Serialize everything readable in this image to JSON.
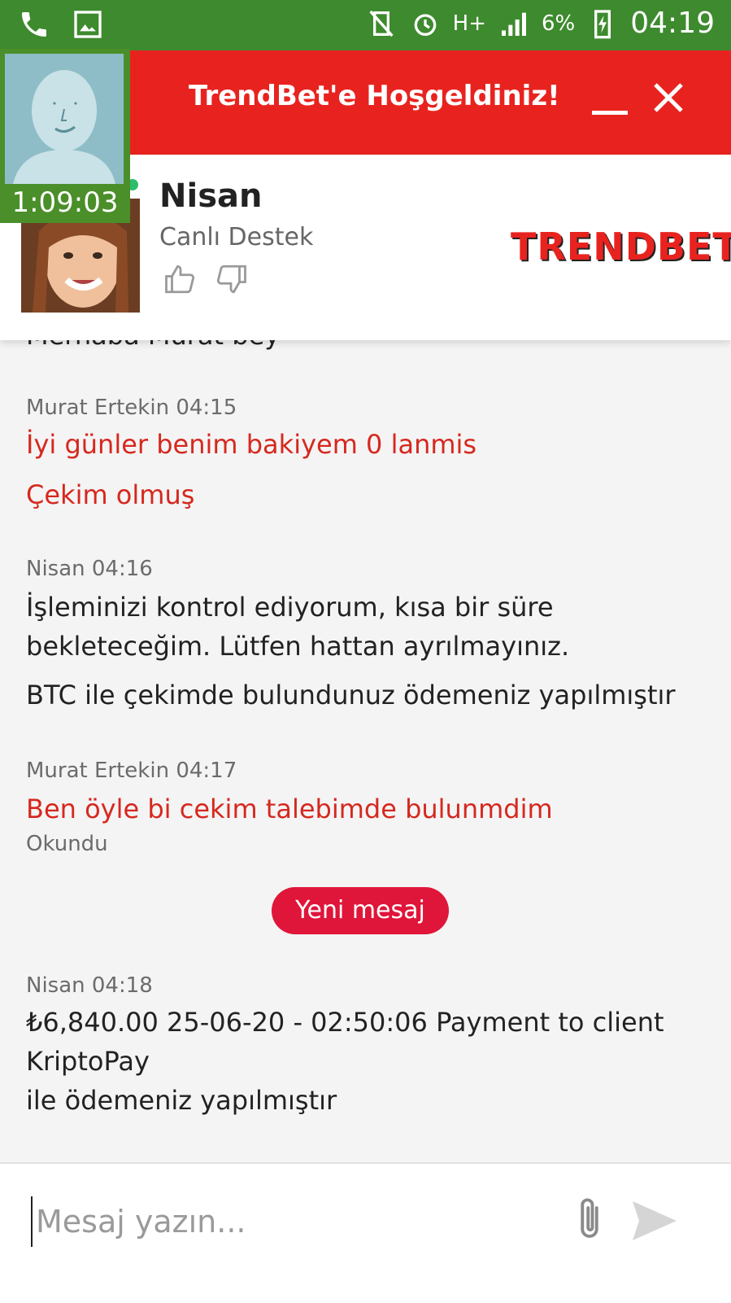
{
  "status_bar": {
    "battery": "6%",
    "time": "04:19",
    "network": "H+",
    "icons": [
      "phone-icon",
      "gallery-icon",
      "vibrate-off-icon",
      "alarm-icon",
      "signal-icon",
      "battery-charging-icon"
    ]
  },
  "header": {
    "title": "TrendBet'e Hoşgeldiniz!",
    "minimize_icon": "minimize-icon",
    "close_icon": "close-icon"
  },
  "video": {
    "timer": "1:09:03"
  },
  "agent": {
    "name": "Nisan",
    "role": "Canlı Destek",
    "brand": "TRENDBET",
    "online": true
  },
  "messages": {
    "partial_previous": "Merhaba Murat bey",
    "m1": {
      "meta": "Murat Ertekin 04:15",
      "line1": "İyi günler benim bakiyem 0 lanmis",
      "line2": "Çekim olmuş"
    },
    "m2": {
      "meta": "Nisan 04:16",
      "line1": "İşleminizi kontrol ediyorum, kısa bir süre bekleteceğim. Lütfen hattan ayrılmayınız.",
      "line2": "BTC ile çekimde bulundunuz ödemeniz yapılmıştır"
    },
    "m3": {
      "meta": "Murat Ertekin 04:17",
      "line1": "Ben öyle bi cekim talebimde bulunmdim",
      "read_status": "Okundu"
    },
    "new_message_label": "Yeni mesaj",
    "m4": {
      "meta": "Nisan 04:18",
      "line1": "₺6,840.00 25-06-20 - 02:50:06 Payment to client\nKriptoPay\nile ödemeniz yapılmıştır"
    }
  },
  "composer": {
    "placeholder": "Mesaj yazın...",
    "value": ""
  },
  "colors": {
    "status_bar": "#3e8a2e",
    "header": "#e8231f",
    "user_message": "#d6281f",
    "new_message_button": "#e0153a",
    "online": "#2ebd6b"
  }
}
